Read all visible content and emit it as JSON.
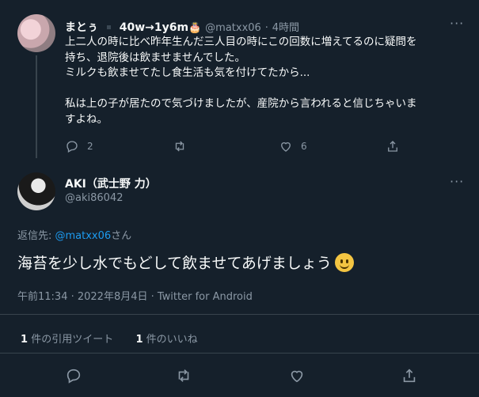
{
  "parent_tweet": {
    "display_name": "まとぅ",
    "name_extra": "40w→1y6m",
    "name_emoji": "🎂",
    "handle": "@matxx06",
    "time": "4時間",
    "lines": [
      "上二人の時に比べ昨年生んだ三人目の時にこの回数に増えてるのに疑問を",
      "持ち、退院後は飲ませませんでした。",
      "ミルクも飲ませてたし食生活も気を付けてたから...",
      "",
      "私は上の子が居たので気づけましたが、産院から言われると信じちゃいま",
      "すよね。"
    ],
    "reply_count": "2",
    "like_count": "6"
  },
  "main_tweet": {
    "display_name": "AKI（武士野 力）",
    "handle": "@aki86042",
    "reply_prefix": "返信先: ",
    "reply_to_handle": "@matxx06",
    "reply_suffix": "さん",
    "text": "海苔を少し水でもどして飲ませてあげましょう",
    "timestamp": "午前11:34 · 2022年8月4日 · Twitter for Android",
    "quote_count": "1",
    "quote_label": "件の引用ツイート",
    "like_count": "1",
    "like_label": "件のいいね"
  },
  "colors": {
    "background": "#15202b",
    "accent": "#1d9bf0",
    "muted": "#8b98a5"
  }
}
